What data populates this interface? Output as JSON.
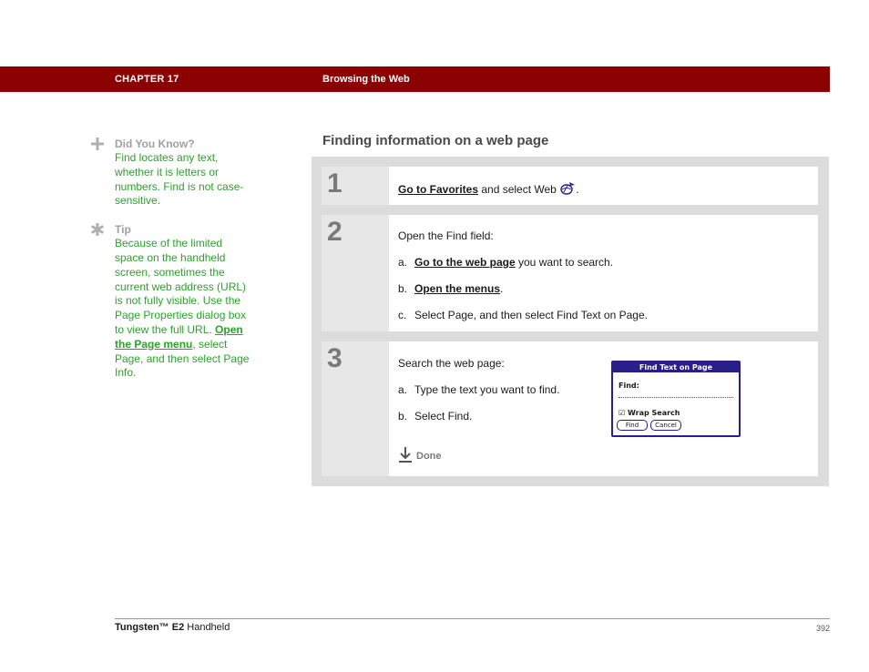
{
  "header": {
    "chapter": "CHAPTER 17",
    "title": "Browsing the Web",
    "bar_color": "#8b0000"
  },
  "sidebar": {
    "did_you_know": {
      "icon": "plus-icon",
      "heading": "Did You Know?",
      "text": "Find locates any text, whether it is letters or numbers. Find is not case-sensitive."
    },
    "tip": {
      "icon": "asterisk-icon",
      "heading": "Tip",
      "text_before": "Because of the limited space on the handheld screen, sometimes the current web address (URL) is not fully visible. Use the Page Properties dialog box to view the full URL. ",
      "link": "Open the Page menu",
      "text_after": ", select Page, and then select Page Info."
    }
  },
  "main": {
    "section_title": "Finding information on a web page",
    "steps": [
      {
        "number": "1",
        "link": "Go to Favorites",
        "text": " and select Web ",
        "icon": "web-browser-icon",
        "end": "."
      },
      {
        "number": "2",
        "intro": "Open the Find field:",
        "items": [
          {
            "label": "a.",
            "link": "Go to the web page",
            "text": " you want to search."
          },
          {
            "label": "b.",
            "link": "Open the menus",
            "text": "."
          },
          {
            "label": "c.",
            "link": "",
            "text": "Select Page, and then select Find Text on Page."
          }
        ]
      },
      {
        "number": "3",
        "intro": "Search the web page:",
        "items": [
          {
            "label": "a.",
            "text": "Type the text you want to find."
          },
          {
            "label": "b.",
            "text": "Select Find."
          }
        ],
        "done": "Done",
        "dialog": {
          "title": "Find Text on Page",
          "field_label": "Find:",
          "checkbox_label": "Wrap Search",
          "checkbox_checked": true,
          "find_button": "Find",
          "cancel_button": "Cancel"
        }
      }
    ]
  },
  "footer": {
    "product_name": "Tungsten™ E2",
    "product_suffix": " Handheld",
    "page_number": "392"
  }
}
